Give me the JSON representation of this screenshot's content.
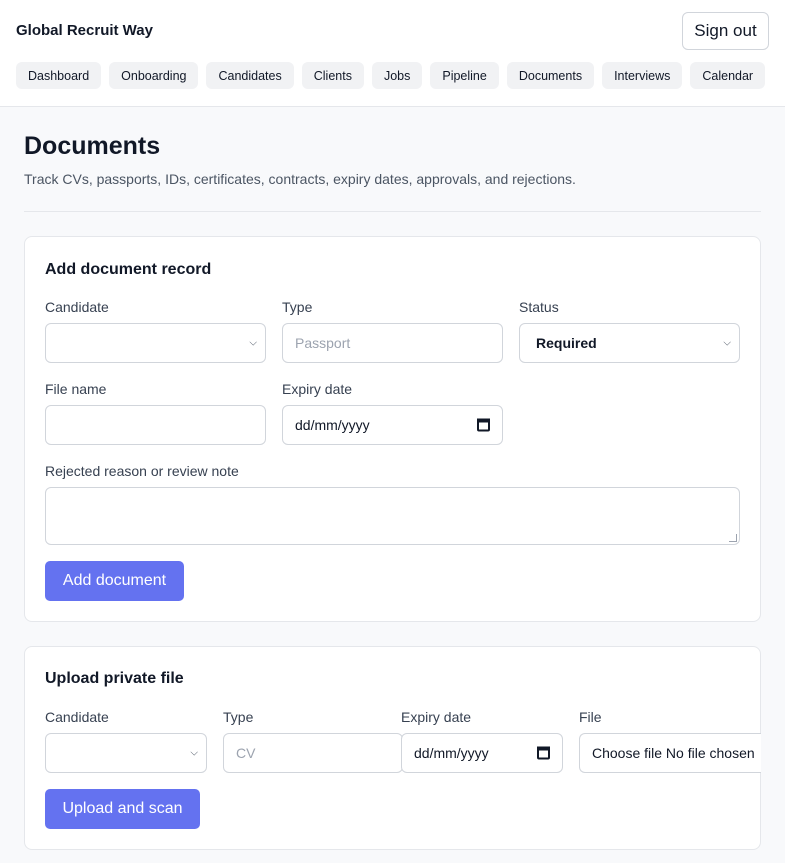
{
  "app": {
    "brand": "Global Recruit Way",
    "sign_out": "Sign out"
  },
  "nav": [
    "Dashboard",
    "Onboarding",
    "Candidates",
    "Clients",
    "Jobs",
    "Pipeline",
    "Documents",
    "Interviews",
    "Calendar"
  ],
  "page": {
    "title": "Documents",
    "subtitle": "Track CVs, passports, IDs, certificates, contracts, expiry dates, approvals, and rejections."
  },
  "add_form": {
    "title": "Add document record",
    "candidate_label": "Candidate",
    "candidate_value": "",
    "type_label": "Type",
    "type_placeholder": "Passport",
    "status_label": "Status",
    "status_value": "Required",
    "file_name_label": "File name",
    "file_name_value": "",
    "expiry_label": "Expiry date",
    "expiry_placeholder": "dd/mm/yyyy",
    "note_label": "Rejected reason or review note",
    "note_value": "",
    "submit": "Add document"
  },
  "upload_form": {
    "title": "Upload private file",
    "candidate_label": "Candidate",
    "candidate_value": "",
    "type_label": "Type",
    "type_placeholder": "CV",
    "expiry_label": "Expiry date",
    "expiry_placeholder": "dd/mm/yyyy",
    "file_label": "File",
    "file_value": "Choose file No file chosen",
    "submit": "Upload and scan"
  },
  "colors": {
    "accent": "#6472f0",
    "border": "#d1d5db",
    "background": "#f8f9fb"
  }
}
